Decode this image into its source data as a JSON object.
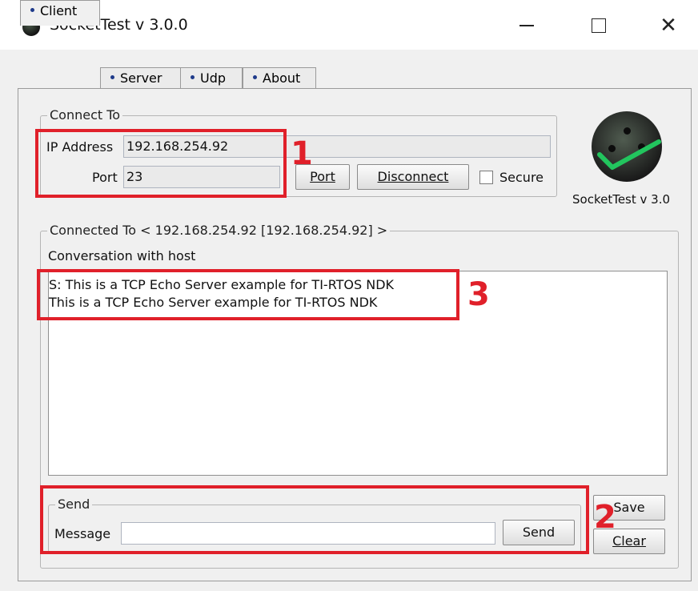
{
  "window": {
    "title": "SocketTest v 3.0.0",
    "minimize_label": "—",
    "close_label": "✕"
  },
  "tabs": [
    {
      "label": "Client",
      "active": true
    },
    {
      "label": "Server",
      "active": false
    },
    {
      "label": "Udp",
      "active": false
    },
    {
      "label": "About",
      "active": false
    }
  ],
  "connect": {
    "legend": "Connect To",
    "ip_label": "IP Address",
    "ip_value": "192.168.254.92",
    "port_label": "Port",
    "port_value": "23",
    "port_button": "Port",
    "disconnect_button": "Disconnect",
    "secure_label": "Secure",
    "secure_checked": false
  },
  "logo": {
    "caption": "SocketTest v 3.0",
    "check_color": "#22c55e"
  },
  "connected": {
    "legend": "Connected To <  192.168.254.92 [192.168.254.92]  >",
    "conversation_label": "Conversation with host",
    "lines": [
      "S: This is a TCP Echo Server example for TI-RTOS NDK",
      "This is a TCP Echo Server example for TI-RTOS NDK"
    ]
  },
  "send": {
    "legend": "Send",
    "message_label": "Message",
    "message_value": "",
    "send_button": "Send",
    "save_button": "Save",
    "clear_button": "Clear"
  },
  "annotations": {
    "color": "#e0202a",
    "labels": [
      "1",
      "2",
      "3"
    ]
  }
}
